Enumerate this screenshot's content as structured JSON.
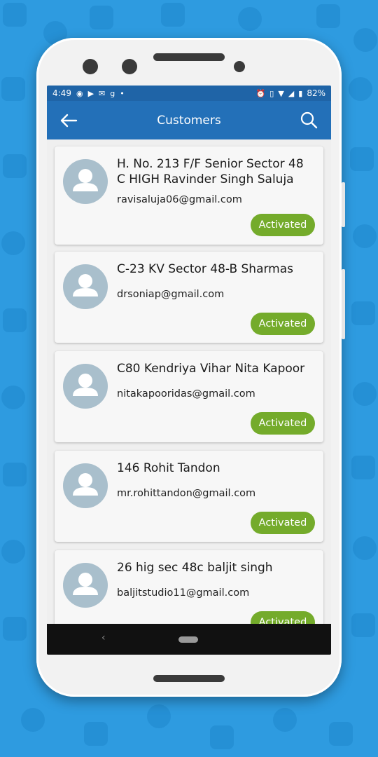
{
  "statusbar": {
    "time": "4:49",
    "battery": "82%",
    "left_icons": [
      "whatsapp-icon",
      "youtube-icon",
      "mail-icon",
      "gpay-icon"
    ],
    "right_icons": [
      "alarm-icon",
      "vibrate-icon",
      "wifi-icon",
      "signal-icon",
      "battery-icon"
    ]
  },
  "appbar": {
    "title": "Customers"
  },
  "customers": [
    {
      "name": "H. No. 213 F/F Senior  Sector 48 C HIGH Ravinder Singh Saluja",
      "email": "ravisaluja06@gmail.com",
      "status": "Activated"
    },
    {
      "name": "C-23 KV Sector 48-B Sharmas",
      "email": "drsoniap@gmail.com",
      "status": "Activated"
    },
    {
      "name": "C80 Kendriya Vihar Nita Kapoor",
      "email": "nitakapooridas@gmail.com",
      "status": "Activated"
    },
    {
      "name": "146 Rohit Tandon",
      "email": "mr.rohittandon@gmail.com",
      "status": "Activated"
    },
    {
      "name": "26 hig sec 48c baljit singh",
      "email": "baljitstudio11@gmail.com",
      "status": "Activated"
    }
  ],
  "colors": {
    "appbar": "#2370b8",
    "statusbar": "#1f64a7",
    "badge": "#74ab2b",
    "background": "#2e9be0"
  }
}
